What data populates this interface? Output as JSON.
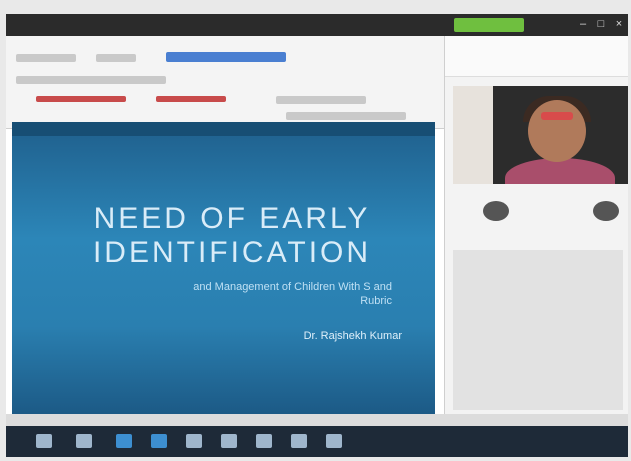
{
  "window": {
    "controls": [
      "–",
      "□",
      "×"
    ]
  },
  "slide": {
    "title_line1": "NEED OF EARLY",
    "title_line2": "IDENTIFICATION",
    "subtitle_line1": "and Management of Children With S and",
    "subtitle_line2": "Rubric",
    "author": "Dr. Rajshekh Kumar"
  },
  "meeting": {
    "participants": [
      "",
      ""
    ]
  },
  "taskbar": {
    "icons": [
      "start-icon",
      "file-explorer-icon",
      "edge-icon",
      "store-icon",
      "mail-icon",
      "word-icon",
      "powerpoint-icon",
      "chat-icon",
      "camera-icon"
    ],
    "tray_text": ""
  },
  "colors": {
    "slide_blue": "#2a7fb0",
    "ribbon_accent": "#e67e22",
    "meeting_accent": "#6fbf3f",
    "taskbar": "#1e2a38"
  }
}
